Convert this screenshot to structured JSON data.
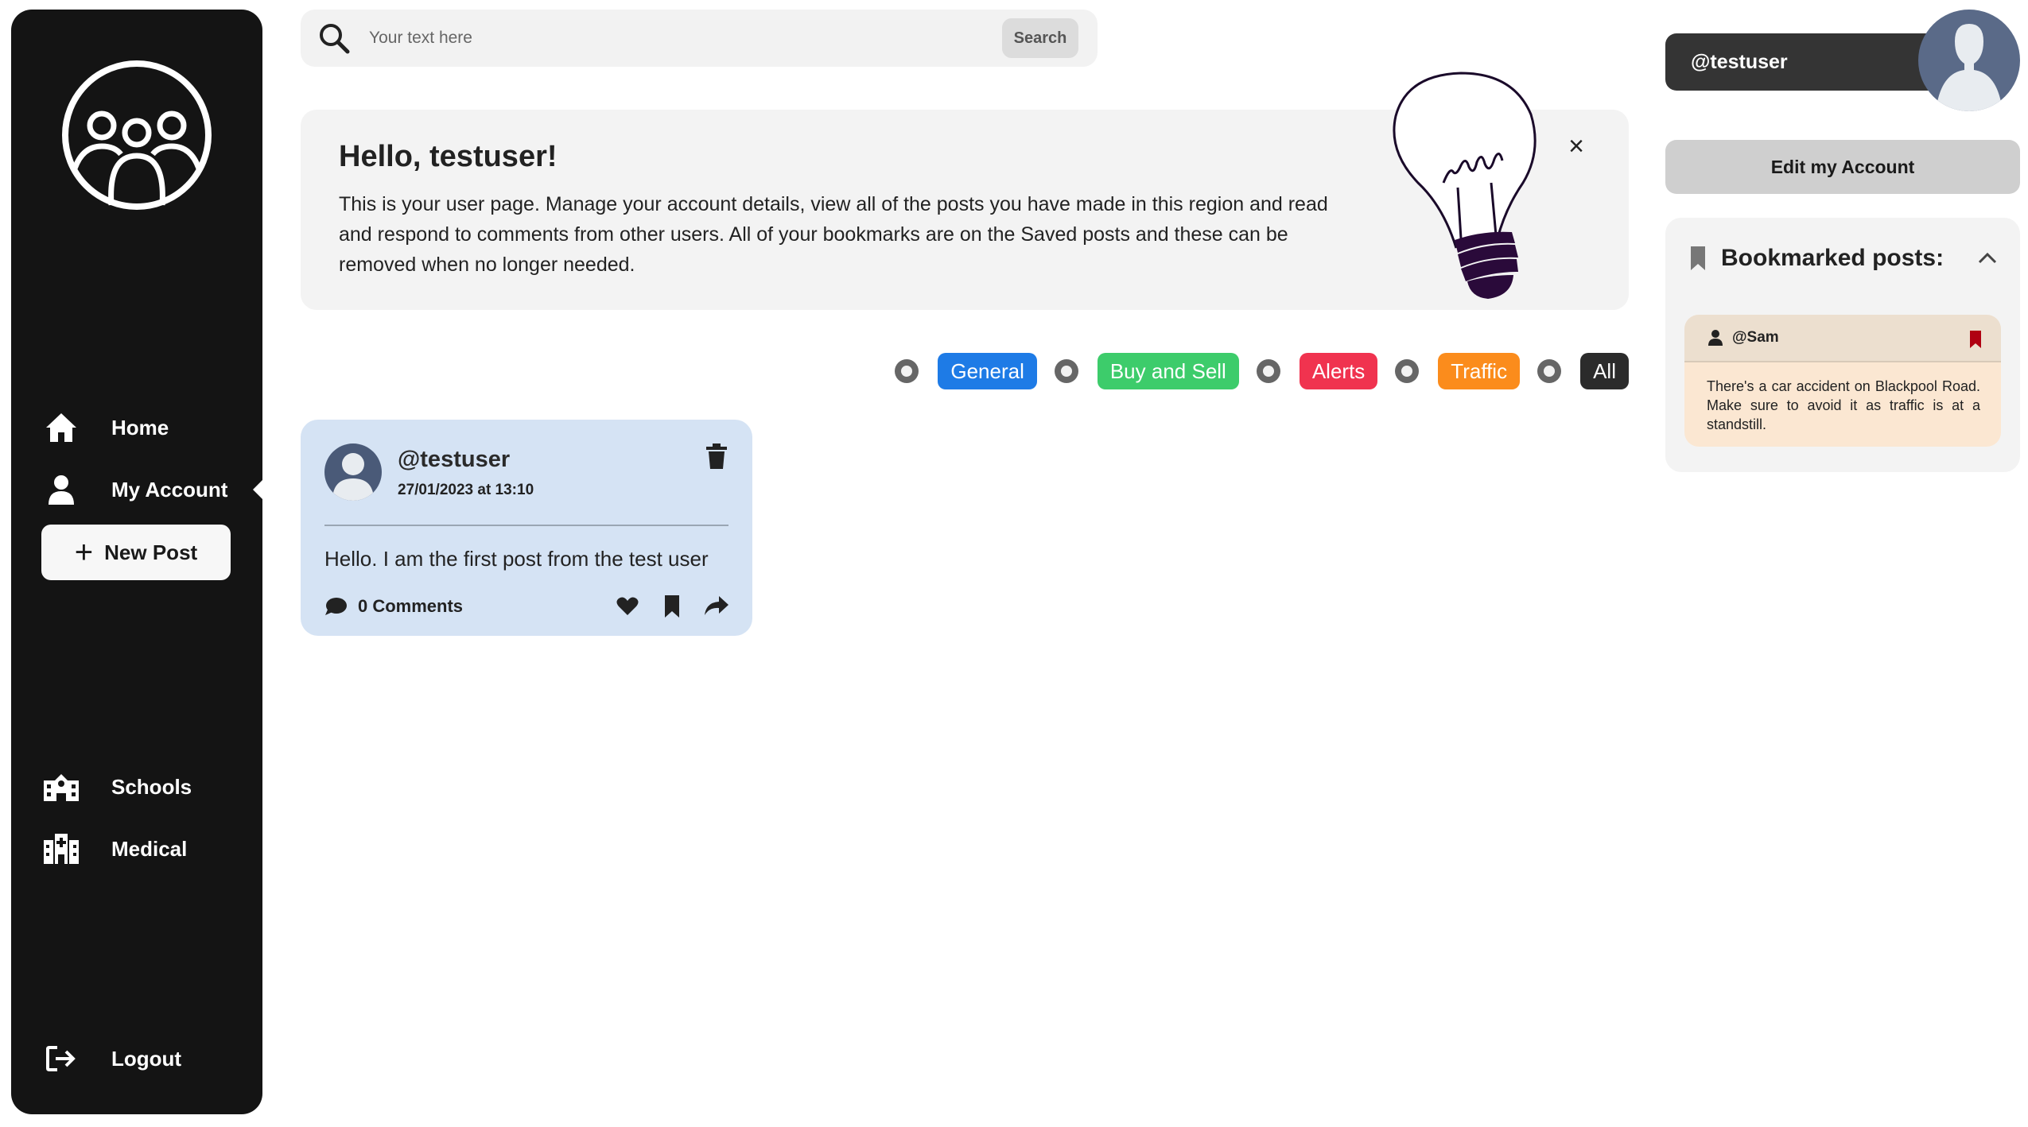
{
  "sidebar": {
    "nav": {
      "home": "Home",
      "my_account": "My Account",
      "new_post": "New Post",
      "schools": "Schools",
      "medical": "Medical",
      "logout": "Logout"
    }
  },
  "search": {
    "placeholder": "Your text here",
    "button": "Search"
  },
  "banner": {
    "title": "Hello, testuser!",
    "text": "This is your user page. Manage your account details, view all of the posts you have made in this region and read and respond to comments from other users. All of your bookmarks are on the Saved posts and these can be removed when no longer needed.",
    "close": "×"
  },
  "filters": [
    {
      "label": "General",
      "color": "#1e7be6"
    },
    {
      "label": "Buy and Sell",
      "color": "#3dcc6b"
    },
    {
      "label": "Alerts",
      "color": "#f0334f"
    },
    {
      "label": "Traffic",
      "color": "#fb8c1c"
    },
    {
      "label": "All",
      "color": "#2b2b2b"
    }
  ],
  "post": {
    "user": "@testuser",
    "date": "27/01/2023 at 13:10",
    "body": "Hello. I am the first post from the test user",
    "comments": "0 Comments"
  },
  "profile": {
    "username": "@testuser",
    "edit_button": "Edit my Account"
  },
  "bookmarks": {
    "title": "Bookmarked posts:",
    "items": [
      {
        "user": "@Sam",
        "text": "There's a car accident on Blackpool Road. Make sure to avoid it as traffic is at a standstill."
      }
    ]
  },
  "colors": {
    "sidebar": "#141414",
    "post_bg": "#d5e3f4",
    "bookmark_bg": "#fbe7d2",
    "bookmark_flag": "#b00012"
  }
}
